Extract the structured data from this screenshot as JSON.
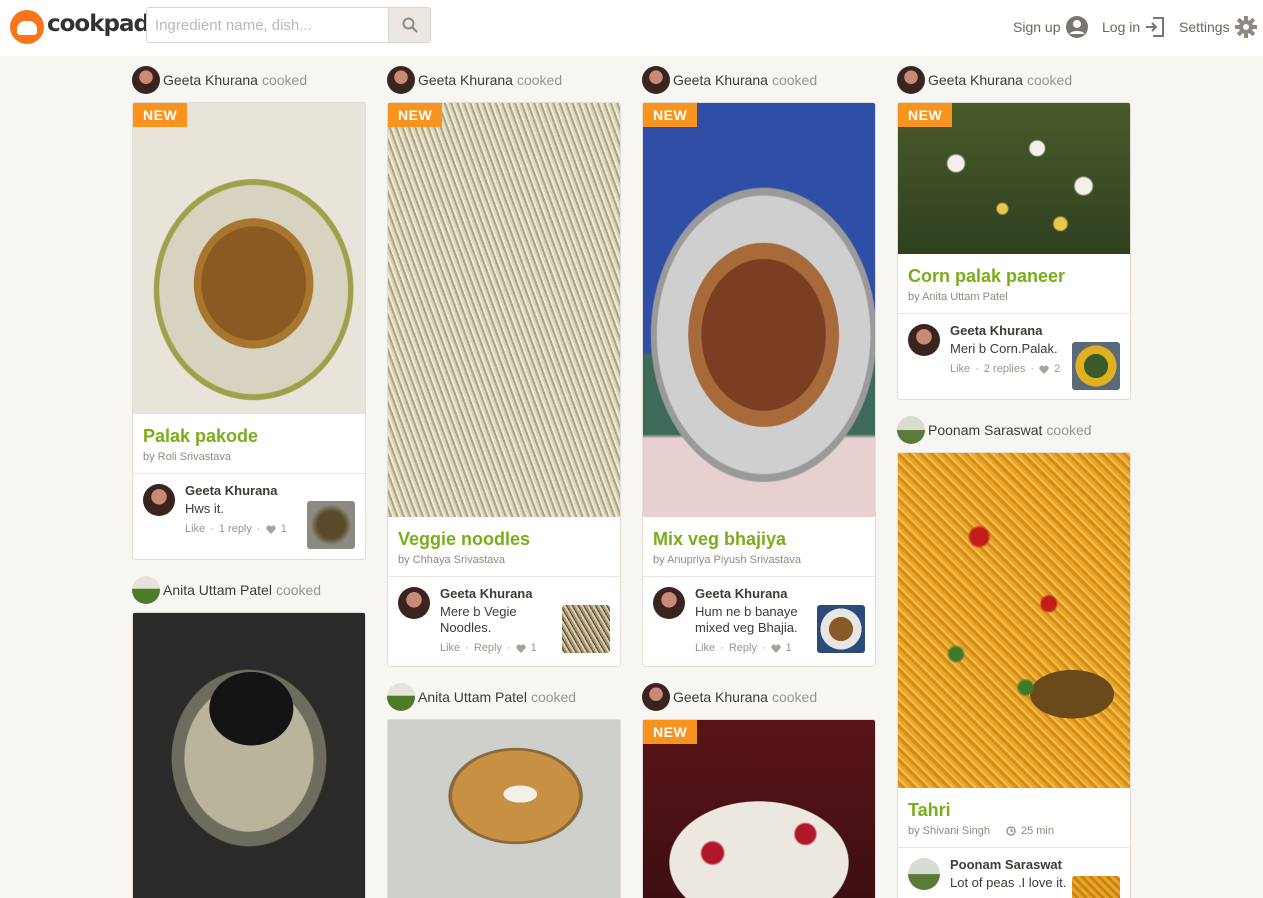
{
  "header": {
    "logo_text": "cookpad",
    "search_placeholder": "Ingredient name, dish...",
    "signup_label": "Sign up",
    "login_label": "Log in",
    "settings_label": "Settings"
  },
  "feed": {
    "cooked_word": "cooked",
    "new_badge": "NEW",
    "cards": [
      {
        "user": "Geeta Khurana",
        "title": "Palak pakode",
        "byline": "by Roli Srivastava",
        "commenter": "Geeta Khurana",
        "comment": "Hws it.",
        "like": "Like",
        "replies": "1 reply",
        "likes": "1"
      },
      {
        "user": "Anita Uttam Patel"
      },
      {
        "user": "Geeta Khurana",
        "title": "Veggie noodles",
        "byline": "by Chhaya Srivastava",
        "commenter": "Geeta Khurana",
        "comment": "Mere b Vegie Noodles.",
        "like": "Like",
        "replies": "Reply",
        "likes": "1"
      },
      {
        "user": "Anita Uttam Patel"
      },
      {
        "user": "Geeta Khurana",
        "title": "Mix veg bhajiya",
        "byline": "by Anupriya Piyush Srivastava",
        "commenter": "Geeta Khurana",
        "comment": "Hum ne b banaye mixed veg Bhajia.",
        "like": "Like",
        "replies": "Reply",
        "likes": "1"
      },
      {
        "user": "Geeta Khurana"
      },
      {
        "user": "Geeta Khurana",
        "title": "Corn palak paneer",
        "byline": "by Anita Uttam Patel",
        "commenter": "Geeta Khurana",
        "comment": "Meri b Corn.Palak.",
        "like": "Like",
        "replies": "2 replies",
        "likes": "2"
      },
      {
        "user": "Poonam Saraswat",
        "title": "Tahri",
        "byline": "by Shivani Singh",
        "time": "25 min",
        "commenter": "Poonam Saraswat",
        "comment": "Lot of peas .I love it."
      }
    ]
  },
  "colors": {
    "accent": "#f8941d",
    "title_green": "#7aad1a",
    "brand_orange": "#f8751a"
  }
}
